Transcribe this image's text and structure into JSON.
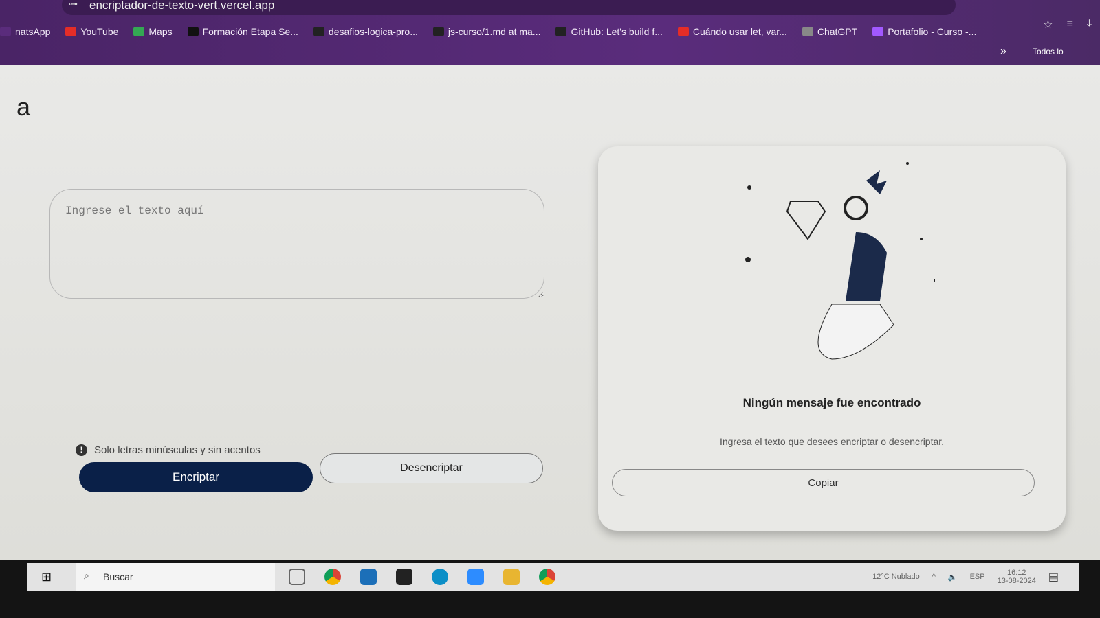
{
  "browser": {
    "url": "encriptador-de-texto-vert.vercel.app",
    "bookmarks": [
      {
        "label": "natsApp",
        "color": "#5a2c7c"
      },
      {
        "label": "YouTube",
        "color": "#e52d27"
      },
      {
        "label": "Maps",
        "color": "#34a853"
      },
      {
        "label": "Formación Etapa Se...",
        "color": "#111"
      },
      {
        "label": "desafios-logica-pro...",
        "color": "#222"
      },
      {
        "label": "js-curso/1.md at ma...",
        "color": "#222"
      },
      {
        "label": "GitHub: Let's build f...",
        "color": "#222"
      },
      {
        "label": "Cuándo usar let, var...",
        "color": "#e52d27"
      },
      {
        "label": "ChatGPT",
        "color": "#888"
      },
      {
        "label": "Portafolio - Curso -...",
        "color": "#a259ff"
      }
    ],
    "more": "»",
    "all_bookmarks": "Todos lo"
  },
  "app": {
    "logo": "a",
    "placeholder": "Ingrese el texto aquí",
    "hint": "Solo letras minúsculas y sin acentos",
    "hint_icon": "!",
    "encrypt": "Encriptar",
    "decrypt": "Desencriptar",
    "empty_title": "Ningún mensaje fue encontrado",
    "empty_text": "Ingresa el texto que desees encriptar o desencriptar.",
    "copy": "Copiar"
  },
  "taskbar": {
    "search": "Buscar",
    "weather": "12°C  Nublado",
    "lang": "ESP",
    "time": "16:12",
    "date": "13-08-2024"
  }
}
